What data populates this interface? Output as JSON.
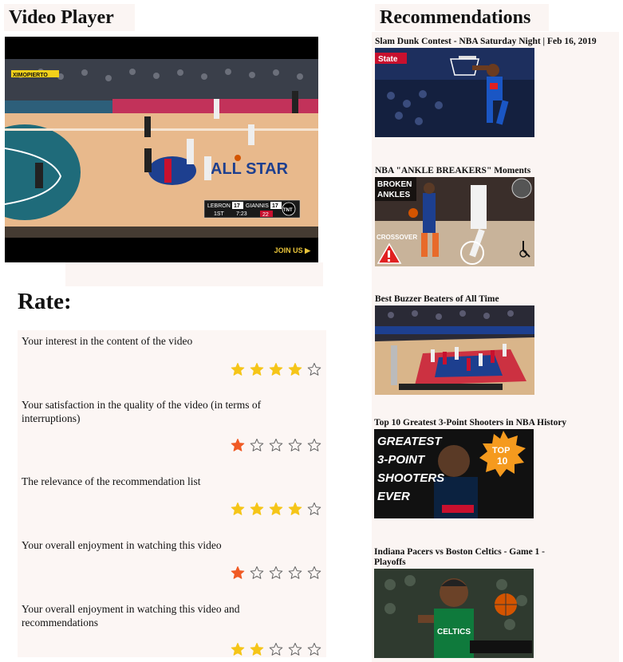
{
  "player": {
    "title": "Video Player",
    "overlay_brand": "XIMOPIERTO",
    "court_text": "ALL STAR",
    "score": {
      "team1": "LEBRON",
      "score1": "17",
      "team2": "GIANNIS",
      "score2": "17",
      "quarter": "1ST",
      "clock": "7:23",
      "shot_clock": "22",
      "network": "TNT"
    },
    "join_label": "JOIN US"
  },
  "rate": {
    "heading": "Rate:",
    "questions": [
      {
        "label": "Your interest in the content of the video",
        "rating": 4,
        "star_color": "#f5c518"
      },
      {
        "label": "Your satisfaction in the quality of the video (in terms of interruptions)",
        "rating": 1,
        "star_color": "#f05a24"
      },
      {
        "label": "The relevance of the recommendation list",
        "rating": 4,
        "star_color": "#f5c518"
      },
      {
        "label": "Your overall enjoyment in watching this video",
        "rating": 1,
        "star_color": "#f05a24"
      },
      {
        "label": "Your overall enjoyment in watching this video and recommendations",
        "rating": 2,
        "star_color": "#f5c518"
      }
    ]
  },
  "recommendations": {
    "title": "Recommendations",
    "items": [
      {
        "title": "Slam Dunk Contest - NBA Saturday Night | Feb 16, 2019",
        "thumb_text": "State"
      },
      {
        "title": "NBA \"ANKLE BREAKERS\" Moments",
        "thumb_text": [
          "BROKEN",
          "ANKLES",
          "CROSSOVER"
        ]
      },
      {
        "title": "Best Buzzer Beaters of All Time",
        "thumb_text": ""
      },
      {
        "title": "Top 10 Greatest 3-Point Shooters in NBA History",
        "thumb_text": [
          "GREATEST",
          "3-POINT",
          "SHOOTERS",
          "EVER",
          "TOP",
          "10"
        ]
      },
      {
        "title": "Indiana Pacers vs Boston Celtics - Game 1 - Playoffs",
        "thumb_text": "CELTICS"
      }
    ]
  },
  "colors": {
    "panel_bg": "#fcf6f4",
    "star_gold": "#f5c518",
    "star_orange": "#f05a24",
    "star_empty_stroke": "#666666"
  }
}
